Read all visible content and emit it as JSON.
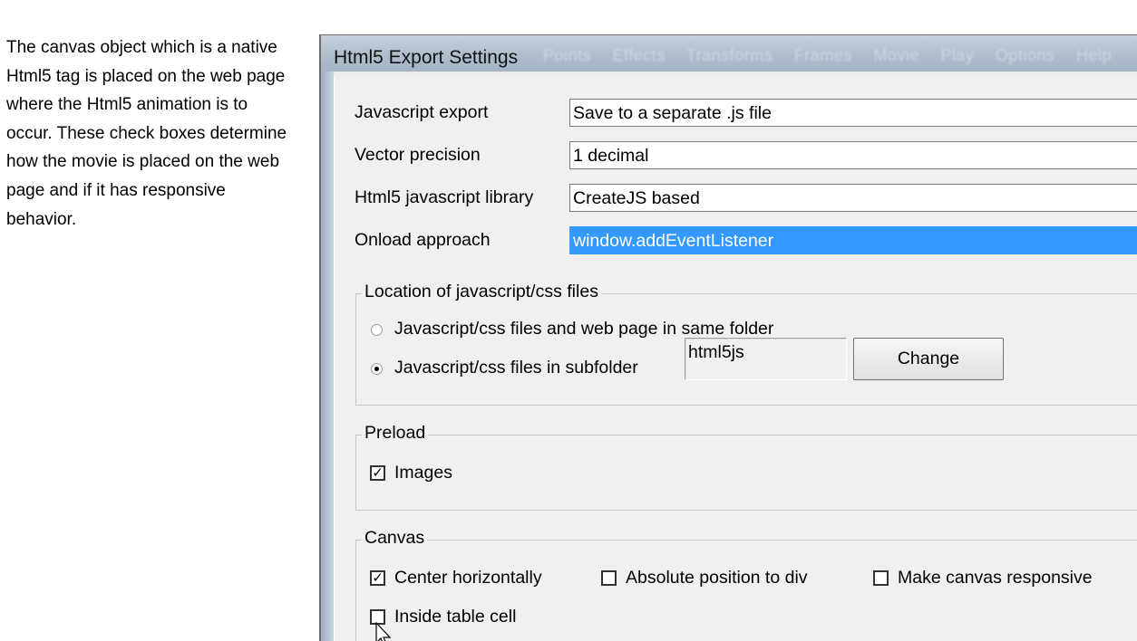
{
  "description": "The canvas object which is a native\nHtml5 tag is placed on the web page\nwhere the Html5 animation is to\noccur. These check boxes determine\nhow the movie is placed on the web\npage and if it has responsive\nbehavior.",
  "window": {
    "title": "Html5 Export Settings",
    "background_menu": [
      "Points",
      "Effects",
      "Transforms",
      "Frames",
      "Movie",
      "Play",
      "Options",
      "Help"
    ]
  },
  "settings": {
    "javascript_export": {
      "label": "Javascript export",
      "value": "Save to a separate .js file"
    },
    "vector_precision": {
      "label": "Vector precision",
      "value": "1 decimal"
    },
    "library": {
      "label": "Html5 javascript library",
      "value": "CreateJS based"
    },
    "onload": {
      "label": "Onload approach",
      "value": "window.addEventListener"
    }
  },
  "location_group": {
    "title": "Location of javascript/css files",
    "option_same": {
      "label": "Javascript/css files and web page in same folder",
      "selected": false
    },
    "option_sub": {
      "label": "Javascript/css files in subfolder",
      "selected": true
    },
    "folder": "html5js",
    "change_button": "Change"
  },
  "preload_group": {
    "title": "Preload",
    "images": {
      "label": "Images",
      "checked": true
    }
  },
  "canvas_group": {
    "title": "Canvas",
    "center": {
      "label": "Center horizontally",
      "checked": true
    },
    "absolute": {
      "label": "Absolute position to div",
      "checked": false
    },
    "responsive": {
      "label": "Make canvas responsive",
      "checked": false
    },
    "table_cell": {
      "label": "Inside table cell",
      "checked": false
    }
  },
  "check_glyph": "✓",
  "colors": {
    "selection": "#3399ff",
    "titlebar": "#aebccb",
    "dialog_bg": "#f0f0f0"
  }
}
